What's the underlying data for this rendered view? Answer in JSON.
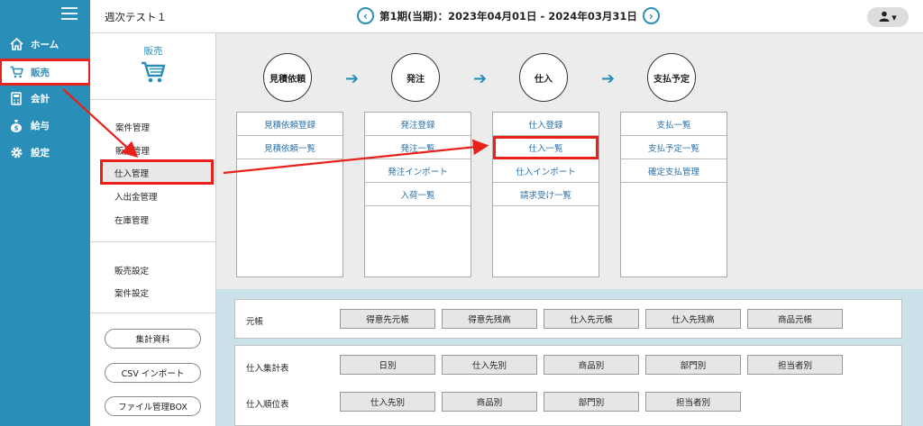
{
  "nav": {
    "items": [
      {
        "label": "ホーム",
        "icon": "home-icon"
      },
      {
        "label": "販売",
        "icon": "cart-icon"
      },
      {
        "label": "会計",
        "icon": "calculator-icon"
      },
      {
        "label": "給与",
        "icon": "money-bag-icon"
      },
      {
        "label": "設定",
        "icon": "gear-icon"
      }
    ]
  },
  "header": {
    "title": "週次テスト１",
    "period": "第1期(当期)：2023年04月01日 - 2024年03月31日",
    "prev": "‹",
    "next": "›",
    "user_caret": "▾"
  },
  "subside": {
    "section_title": "販売",
    "links_group1": [
      "案件管理",
      "販売管理",
      "仕入管理",
      "入出金管理",
      "在庫管理"
    ],
    "links_group2": [
      "販売設定",
      "案件設定"
    ],
    "pills": [
      "集計資料",
      "CSV インポート",
      "ファイル管理BOX"
    ]
  },
  "flow": {
    "steps": [
      "見積依頼",
      "発注",
      "仕入",
      "支払予定"
    ],
    "arrow": "➔",
    "columns": [
      [
        "見積依頼登録",
        "見積依頼一覧"
      ],
      [
        "発注登録",
        "発注一覧",
        "発注インポート",
        "入荷一覧"
      ],
      [
        "仕入登録",
        "仕入一覧",
        "仕入インポート",
        "請求受け一覧"
      ],
      [
        "支払一覧",
        "支払予定一覧",
        "確定支払管理"
      ]
    ]
  },
  "ledger": {
    "motocho": {
      "label": "元帳",
      "buttons": [
        "得意先元帳",
        "得意先残高",
        "仕入先元帳",
        "仕入先残高",
        "商品元帳"
      ]
    },
    "shukei": {
      "label": "仕入集計表",
      "buttons": [
        "日別",
        "仕入先別",
        "商品別",
        "部門別",
        "担当者別"
      ]
    },
    "juni": {
      "label": "仕入順位表",
      "buttons": [
        "仕入先別",
        "商品別",
        "部門別",
        "担当者別"
      ]
    }
  },
  "colors": {
    "accent": "#2a8fb8",
    "highlight": "#e8211b"
  }
}
